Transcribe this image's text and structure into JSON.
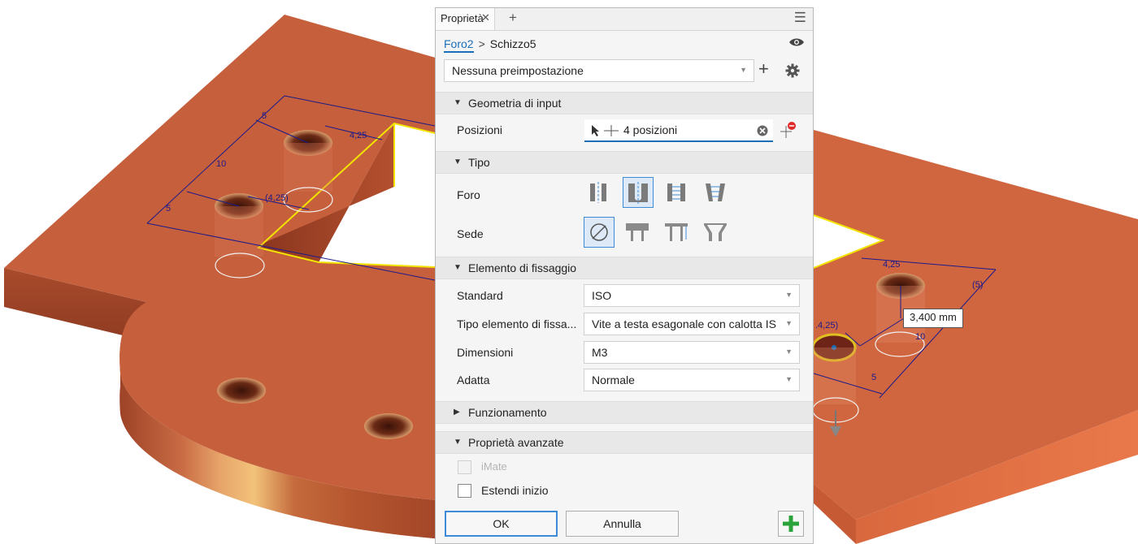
{
  "panel": {
    "tab_label": "Proprietà",
    "tab_close": "✕",
    "tab_add": "+",
    "menu": "☰",
    "breadcrumb": {
      "feature": "Foro2",
      "separator": ">",
      "sketch": "Schizzo5"
    },
    "preset": {
      "value": "Nessuna preimpostazione",
      "add": "+"
    },
    "sections": {
      "input_geometry": {
        "title": "Geometria di input",
        "expanded": true
      },
      "type": {
        "title": "Tipo",
        "expanded": true
      },
      "fastener": {
        "title": "Elemento di fissaggio",
        "expanded": true
      },
      "behavior": {
        "title": "Funzionamento",
        "expanded": false
      },
      "advanced": {
        "title": "Proprietà avanzate",
        "expanded": true
      }
    },
    "positions": {
      "label": "Posizioni",
      "value": "4 posizioni"
    },
    "hole": {
      "label": "Foro",
      "options": [
        "simple-hole-icon",
        "clearance-hole-icon",
        "tapped-hole-icon",
        "taper-tapped-hole-icon"
      ],
      "selected": 1
    },
    "seat": {
      "label": "Sede",
      "options": [
        "no-seat-icon",
        "counterbore-icon",
        "spotface-icon",
        "countersink-icon"
      ],
      "selected": 0
    },
    "standard": {
      "label": "Standard",
      "value": "ISO"
    },
    "fastener_type": {
      "label": "Tipo elemento di fissa...",
      "value": "Vite a testa esagonale con calotta IS"
    },
    "size": {
      "label": "Dimensioni",
      "value": "M3"
    },
    "fit": {
      "label": "Adatta",
      "value": "Normale"
    },
    "imate": {
      "label": "iMate",
      "checked": false,
      "enabled": false
    },
    "extend_start": {
      "label": "Estendi inizio",
      "checked": false
    },
    "ok": "OK",
    "cancel": "Annulla",
    "apply": "+"
  },
  "viewport": {
    "tooltip": "3,400 mm",
    "dimensions": [
      "5",
      "10",
      "5",
      "4,25",
      "(4,25)",
      "4,25",
      "(5)",
      "10",
      "5",
      ".4,25)"
    ]
  },
  "colors": {
    "part": "#c8603e",
    "part_dark": "#a94b2c",
    "accent": "#1b6fb8",
    "dimension": "#1a1a8c",
    "edge_highlight": "#f2e400",
    "apply_green": "#2aa33a"
  }
}
